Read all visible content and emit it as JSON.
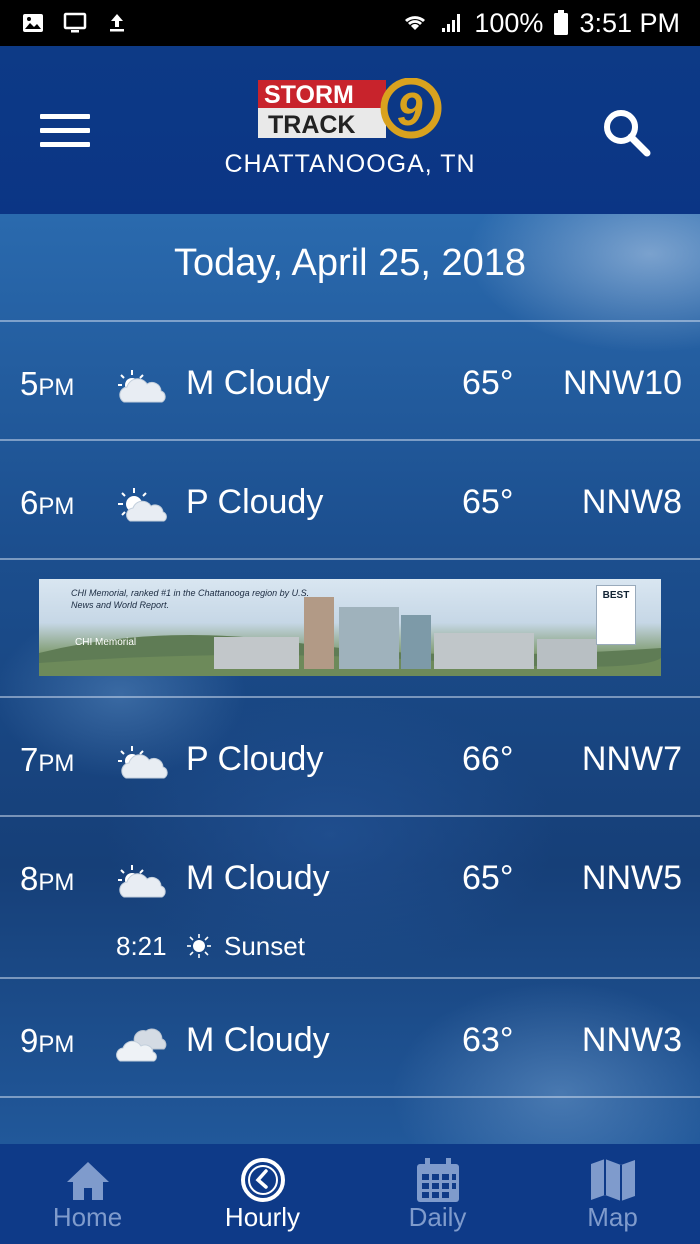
{
  "status_bar": {
    "left_icons": [
      "image-icon",
      "screen-cast-icon",
      "upload-icon"
    ],
    "right_icons": [
      "wifi-icon",
      "signal-icon"
    ],
    "battery": "100%",
    "time": "3:51 PM"
  },
  "header": {
    "logo_line1": "STORM",
    "logo_line2": "TRACK",
    "logo_number": "9",
    "city": "CHATTANOOGA, TN"
  },
  "date_title": "Today, April 25, 2018",
  "rows": [
    {
      "hour": "5",
      "ampm": "PM",
      "condition": "M Cloudy",
      "temp": "65°",
      "wind": "NNW10"
    },
    {
      "hour": "6",
      "ampm": "PM",
      "condition": "P Cloudy",
      "temp": "65°",
      "wind": "NNW8"
    },
    {
      "hour": "7",
      "ampm": "PM",
      "condition": "P Cloudy",
      "temp": "66°",
      "wind": "NNW7"
    },
    {
      "hour": "8",
      "ampm": "PM",
      "condition": "M Cloudy",
      "temp": "65°",
      "wind": "NNW5"
    },
    {
      "hour": "9",
      "ampm": "PM",
      "condition": "M Cloudy",
      "temp": "63°",
      "wind": "NNW3"
    }
  ],
  "sunset": {
    "time": "8:21",
    "label": "Sunset"
  },
  "ad": {
    "caption": "CHI Memorial, ranked #1 in the Chattanooga region by U.S. News and World Report.",
    "brand": "CHI Memorial",
    "badge": "BEST"
  },
  "nav": [
    {
      "label": "Home",
      "icon": "home-icon"
    },
    {
      "label": "Hourly",
      "icon": "clock-icon"
    },
    {
      "label": "Daily",
      "icon": "calendar-icon"
    },
    {
      "label": "Map",
      "icon": "map-icon"
    }
  ],
  "colors": {
    "header_bg": "#0d3a86",
    "nav_bg": "#0e3a88",
    "nav_inactive": "#7f9bcc",
    "logo_red": "#c8232c",
    "logo_gold": "#d9a21e"
  }
}
